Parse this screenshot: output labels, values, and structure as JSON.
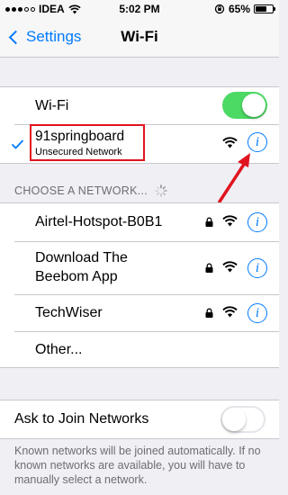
{
  "status": {
    "carrier": "IDEA",
    "time": "5:02 PM",
    "battery": "65%",
    "battery_level": 0.65
  },
  "nav": {
    "back_label": "Settings",
    "title": "Wi-Fi"
  },
  "wifi_toggle": {
    "label": "Wi-Fi",
    "on": true
  },
  "connected": {
    "name": "91springboard",
    "subtitle": "Unsecured Network"
  },
  "choose_header": "CHOOSE A NETWORK...",
  "networks": [
    {
      "name": "Airtel-Hotspot-B0B1"
    },
    {
      "name_line1": "Download The",
      "name_line2": "Beebom App"
    },
    {
      "name": "TechWiser"
    }
  ],
  "other_label": "Other...",
  "ask_join": {
    "label": "Ask to Join Networks",
    "on": false
  },
  "footer": "Known networks will be joined automatically. If no known networks are available, you will have to manually select a network.",
  "colors": {
    "accent": "#007aff",
    "toggle_on": "#4cd964",
    "annotation": "#e0141e"
  },
  "icons": {
    "wifi": "wifi-icon",
    "lock": "lock-icon",
    "info": "info-icon",
    "check": "checkmark-icon"
  }
}
